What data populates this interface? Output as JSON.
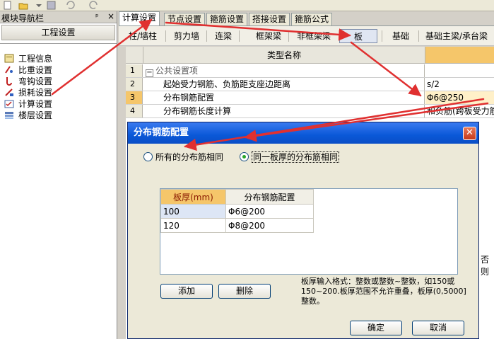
{
  "nav": {
    "title": "模块导航栏",
    "pin": "ᵖ",
    "close": "×",
    "section_button": "工程设置",
    "items": [
      {
        "label": "工程信息",
        "icon": "project-info-icon"
      },
      {
        "label": "比重设置",
        "icon": "weight-settings-icon"
      },
      {
        "label": "弯钩设置",
        "icon": "hook-settings-icon"
      },
      {
        "label": "损耗设置",
        "icon": "loss-settings-icon"
      },
      {
        "label": "计算设置",
        "icon": "calc-settings-icon"
      },
      {
        "label": "楼层设置",
        "icon": "floor-settings-icon"
      }
    ]
  },
  "tabs": [
    "计算设置",
    "节点设置",
    "箍筋设置",
    "搭接设置",
    "箍筋公式"
  ],
  "subtabs": [
    "柱/墙柱",
    "剪力墙",
    "连梁",
    "框架梁",
    "非框架梁",
    "板",
    "基础",
    "基础主梁/承台梁"
  ],
  "grid": {
    "header": "类型名称",
    "rows": [
      {
        "num": "1",
        "name": "公共设置项",
        "value": ""
      },
      {
        "num": "2",
        "name": "起始受力钢筋、负筋距支座边距离",
        "value": "s/2"
      },
      {
        "num": "3",
        "name": "分布钢筋配置",
        "value": "Φ6@250"
      },
      {
        "num": "4",
        "name": "分布钢筋长度计算",
        "value": "和负筋(跨板受力筋"
      }
    ],
    "fragment": "否则"
  },
  "dialog": {
    "title": "分布钢筋配置",
    "radio_all": "所有的分布筋相同",
    "radio_same": "同一板厚的分布筋相同",
    "table": {
      "headers": [
        "板厚(mm)",
        "分布钢筋配置"
      ],
      "rows": [
        [
          "100",
          "Φ6@200"
        ],
        [
          "120",
          "Φ8@200"
        ]
      ]
    },
    "add_button": "添加",
    "delete_button": "删除",
    "hint": "板厚输入格式：整数或整数~整数，如150或150~200.板厚范围不允许重叠，板厚(0,5000]整数。",
    "ok_button": "确定",
    "cancel_button": "取消"
  },
  "colors": {
    "annotation_arrow": "#e03030",
    "title_bar": "#0a58d8",
    "selected_header": "#f5c66a"
  }
}
